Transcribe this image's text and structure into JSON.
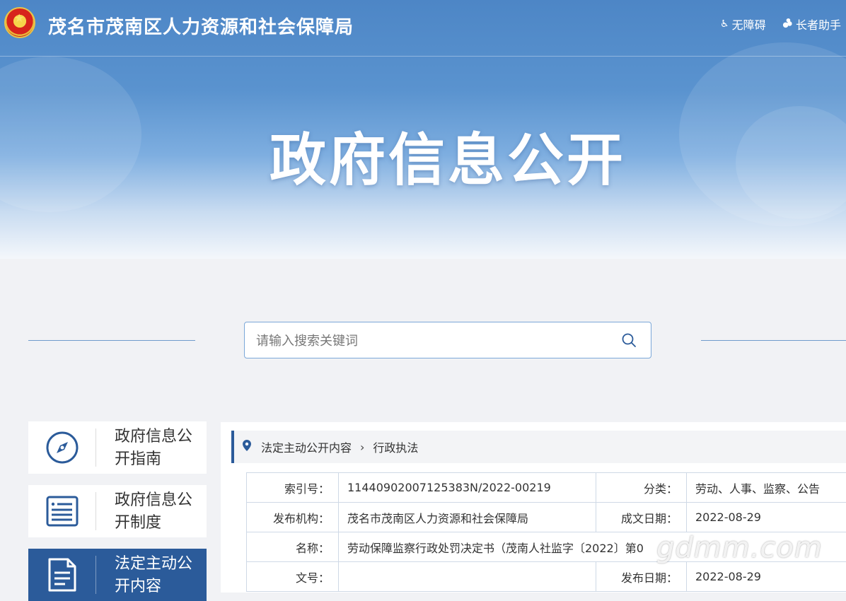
{
  "header": {
    "site_title": "茂名市茂南区人力资源和社会保障局",
    "tools": [
      {
        "label": "无障碍",
        "icon": "wheelchair-icon"
      },
      {
        "label": "长者助手",
        "icon": "elder-assist-icon"
      }
    ],
    "hero_title": "政府信息公开"
  },
  "search": {
    "placeholder": "请输入搜索关键词",
    "value": ""
  },
  "sidebar": {
    "items": [
      {
        "label": "政府信息公开指南",
        "icon": "compass-icon",
        "active": false
      },
      {
        "label": "政府信息公开制度",
        "icon": "list-icon",
        "active": false
      },
      {
        "label": "法定主动公开内容",
        "icon": "document-icon",
        "active": true
      }
    ]
  },
  "breadcrumb": {
    "items": [
      "法定主动公开内容",
      "行政执法"
    ]
  },
  "meta": {
    "index_label": "索引号：",
    "index_value": "11440902007125383N/2022-00219",
    "category_label": "分类：",
    "category_value": "劳动、人事、监察、公告",
    "publisher_label": "发布机构：",
    "publisher_value": "茂名市茂南区人力资源和社会保障局",
    "created_label": "成文日期：",
    "created_value": "2022-08-29",
    "name_label": "名称：",
    "name_value": "劳动保障监察行政处罚决定书（茂南人社监字〔2022〕第0",
    "doc_no_label": "文号：",
    "doc_no_value": "",
    "published_label": "发布日期：",
    "published_value": "2022-08-29"
  },
  "watermark": "gdmm.com",
  "colors": {
    "accent": "#2b5b9a",
    "banner": "#5a93cf",
    "border": "#cfd9e6"
  }
}
